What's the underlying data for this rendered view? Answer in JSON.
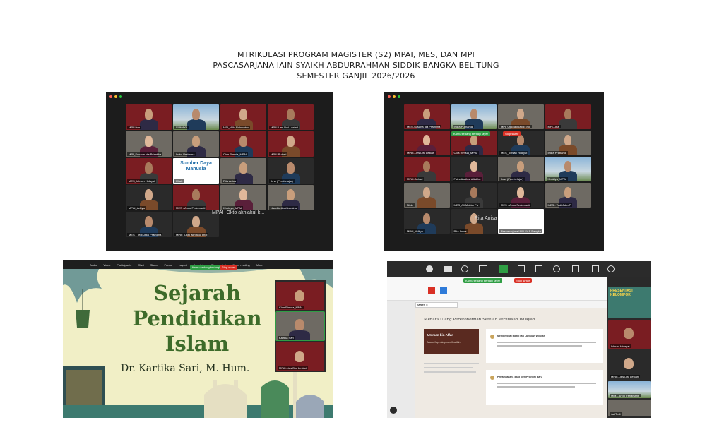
{
  "header": {
    "line1": "MTRIKULASI PROGRAM MAGISTER (S2) MPAI, MES, DAN MPI",
    "line2": "PASCASARJANA IAIN SYAIKH ABDURRAHMAN SIDDIK BANGKA BELITUNG",
    "line3": "SEMESTER GANJIL 2026/2026"
  },
  "gallery1": {
    "tiles": [
      {
        "name": "MPI-Lina",
        "kind": "brand"
      },
      {
        "name": "SUMAYA",
        "kind": "sky"
      },
      {
        "name": "MPI_Wiki Rahmatun",
        "kind": "brand"
      },
      {
        "name": "MPAI-Lies Dwi Lestari",
        "kind": "brand"
      },
      {
        "name": "MPI_Susana Ida Priantika",
        "kind": "room"
      },
      {
        "name": "Indra Prabama",
        "kind": "room"
      },
      {
        "name": "Cica Rimsia_MPAI",
        "kind": "brand"
      },
      {
        "name": "MPAI-Buhari",
        "kind": "brand"
      },
      {
        "name": "MES_Ichsan Hidayat",
        "kind": "brand"
      },
      {
        "name": "Ulfah",
        "kind": "logo"
      },
      {
        "name": "Rita Anisa",
        "kind": "room"
      },
      {
        "name": "Ibnu (Pembelajar)",
        "kind": "dark"
      },
      {
        "name": "MPAI_Aditya",
        "kind": "dark"
      },
      {
        "name": "MES - Andu Ferlamanti",
        "kind": "brand"
      },
      {
        "name": "Khoiriya_MPAI",
        "kind": "room"
      },
      {
        "name": "Nandita Aashiramina",
        "kind": "room"
      },
      {
        "name": "MES - Tedi Jaku Pramana",
        "kind": "dark"
      },
      {
        "name": "MPAI_Okto akhiakul khoi",
        "kind": "dark"
      }
    ],
    "speaker_label": "MPAI_Okto akhiakul k...",
    "logo_text": "Sumber Daya Manusia"
  },
  "gallery2": {
    "tiles": [
      {
        "name": "MES-Susana Ida Pramitha",
        "kind": "brand"
      },
      {
        "name": "Indra Purnama",
        "kind": "sky"
      },
      {
        "name": "MPI_Okto akhiakul khoi",
        "kind": "room"
      },
      {
        "name": "MPI-Lina",
        "kind": "brand"
      },
      {
        "name": "MPAI-Lies Dwi Lestari",
        "kind": "brand"
      },
      {
        "name": "Cica Rimsia_MPAI",
        "kind": "brand"
      },
      {
        "name": "MES_Ichsan Hidayat",
        "kind": "dark"
      },
      {
        "name": "Indra Prabama",
        "kind": "room"
      },
      {
        "name": "MPAI-Buhari",
        "kind": "brand"
      },
      {
        "name": "Fathaika Asshidiakha",
        "kind": "dark"
      },
      {
        "name": "Ibnu (Pembelajar)",
        "kind": "room"
      },
      {
        "name": "Khoiriya_MPAI",
        "kind": "sky"
      },
      {
        "name": "Nikki",
        "kind": "room"
      },
      {
        "name": "MES_Ali Muktar Fa",
        "kind": "dark"
      },
      {
        "name": "MES - Andu Ferlamanti",
        "kind": "dark"
      },
      {
        "name": "MES - Tedi Jaku P",
        "kind": "room"
      },
      {
        "name": "MPAI_Aditya",
        "kind": "dark"
      },
      {
        "name": "Rita Anisa",
        "kind": "dark"
      },
      {
        "name": "Pascasarjana IAIN SAS Bangka Beli",
        "kind": "logo"
      }
    ],
    "rec_label": "Rita Anisa",
    "chip1": "Kamu sedang berbagi layar",
    "chip2": "Stop share"
  },
  "slide": {
    "title_line1": "Sejarah",
    "title_line2": "Pendidikan",
    "title_line3": "Islam",
    "presenter": "Dr. Kartika Sari, M. Hum.",
    "toolbar": [
      "Audio",
      "Video",
      "Participants",
      "Chat",
      "Share",
      "Pause",
      "Layout",
      "Annotate",
      "Stop control",
      "Show reading",
      "More"
    ],
    "chip1": "Kamu sedang berbagi layar",
    "chip2": "Stop share",
    "side_names": [
      "Cica Rimsia_MPAI",
      "Kartika Sari",
      "MPAI-Lies Dwi Lestari"
    ]
  },
  "docapp": {
    "section_title": "Menata Ulang Perekonomian Setelah Perluasan Wilayah",
    "card1_title": "Utsman bin Affan",
    "card1_sub": "Masa Kepemimpinan Khalifah",
    "item1_title": "Memperkuat Baitul Mal Jaringan Wilayah",
    "item2_title": "Penambahan Zakat oleh Provinsi Baru",
    "tab_label": "Materi 5",
    "presenter_label": "PRESENTASI KELOMPOK",
    "side_names": [
      "Ichsan Hidayat",
      "MPAI-Lies Dwi Lestari",
      "Mila - Ando Ferlamanti",
      "Jai Tedi"
    ]
  },
  "colors": {
    "maroon": "#7a1d22",
    "zoom_bg": "#1c1c1c",
    "slide_bg": "#f1efc6",
    "slide_title": "#3d6b2a",
    "rec_red": "#d93025",
    "active_green": "#2f9e44"
  }
}
